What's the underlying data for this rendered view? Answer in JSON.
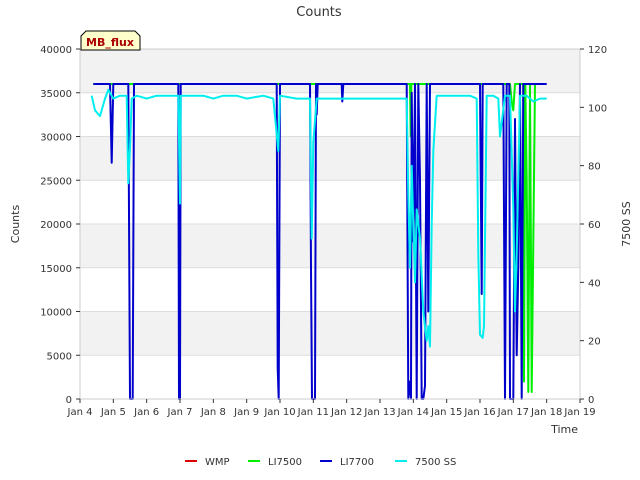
{
  "chart_data": {
    "type": "line",
    "title": "Counts",
    "xlabel": "Time",
    "ylabel": "Counts",
    "y2label": "7500 SS",
    "site_label": "MB_flux",
    "x_ticks": [
      {
        "v": 4,
        "label": "Jan 4"
      },
      {
        "v": 5,
        "label": "Jan 5"
      },
      {
        "v": 6,
        "label": "Jan 6"
      },
      {
        "v": 7,
        "label": "Jan 7"
      },
      {
        "v": 8,
        "label": "Jan 8"
      },
      {
        "v": 9,
        "label": "Jan 9"
      },
      {
        "v": 10,
        "label": "Jan 10"
      },
      {
        "v": 11,
        "label": "Jan 11"
      },
      {
        "v": 12,
        "label": "Jan 12"
      },
      {
        "v": 13,
        "label": "Jan 13"
      },
      {
        "v": 14,
        "label": "Jan 14"
      },
      {
        "v": 15,
        "label": "Jan 15"
      },
      {
        "v": 16,
        "label": "Jan 16"
      },
      {
        "v": 17,
        "label": "Jan 17"
      },
      {
        "v": 18,
        "label": "Jan 18"
      },
      {
        "v": 19,
        "label": "Jan 19"
      }
    ],
    "xlim": [
      4,
      19
    ],
    "ylim": [
      0,
      40000
    ],
    "y_ticks": [
      0,
      5000,
      10000,
      15000,
      20000,
      25000,
      30000,
      35000,
      40000
    ],
    "y2lim": [
      0,
      120
    ],
    "y2_ticks": [
      0,
      20,
      40,
      60,
      80,
      100,
      120
    ],
    "grid": true,
    "legend_position": "bottom-center",
    "series": [
      {
        "name": "WMP",
        "axis": "left",
        "color": "#dd0000",
        "points": []
      },
      {
        "name": "LI7500",
        "axis": "left",
        "color": "#00ee00",
        "points": [
          [
            4.4,
            36000
          ],
          [
            13.9,
            36000
          ],
          [
            13.92,
            30000
          ],
          [
            13.94,
            36000
          ],
          [
            16.9,
            36000
          ],
          [
            16.95,
            34000
          ],
          [
            17.0,
            33000
          ],
          [
            17.05,
            36000
          ],
          [
            17.3,
            36000
          ],
          [
            17.32,
            2000
          ],
          [
            17.36,
            36000
          ],
          [
            17.4,
            25000
          ],
          [
            17.45,
            800
          ],
          [
            17.5,
            36000
          ],
          [
            17.55,
            800
          ],
          [
            17.6,
            18000
          ],
          [
            17.65,
            36000
          ],
          [
            17.7,
            36000
          ]
        ]
      },
      {
        "name": "LI7700",
        "axis": "left",
        "color": "#0000cc",
        "points": [
          [
            4.4,
            36000
          ],
          [
            4.9,
            36000
          ],
          [
            4.95,
            27000
          ],
          [
            5.0,
            36000
          ],
          [
            5.45,
            36000
          ],
          [
            5.5,
            0
          ],
          [
            5.58,
            0
          ],
          [
            5.62,
            36000
          ],
          [
            6.95,
            36000
          ],
          [
            6.97,
            0
          ],
          [
            7.0,
            0
          ],
          [
            7.02,
            36000
          ],
          [
            9.9,
            36000
          ],
          [
            9.93,
            3500
          ],
          [
            9.96,
            0
          ],
          [
            10.0,
            36000
          ],
          [
            10.9,
            36000
          ],
          [
            10.93,
            15000
          ],
          [
            10.96,
            0
          ],
          [
            11.05,
            0
          ],
          [
            11.08,
            36000
          ],
          [
            11.1,
            32500
          ],
          [
            11.13,
            36000
          ],
          [
            11.85,
            36000
          ],
          [
            11.87,
            34000
          ],
          [
            11.9,
            36000
          ],
          [
            13.8,
            36000
          ],
          [
            13.85,
            0
          ],
          [
            13.9,
            2000
          ],
          [
            13.93,
            0
          ],
          [
            13.95,
            35000
          ],
          [
            14.0,
            18000
          ],
          [
            14.05,
            36000
          ],
          [
            14.1,
            0
          ],
          [
            14.15,
            36000
          ],
          [
            14.2,
            25000
          ],
          [
            14.25,
            0
          ],
          [
            14.3,
            0
          ],
          [
            14.35,
            1500
          ],
          [
            14.4,
            36000
          ],
          [
            14.45,
            10000
          ],
          [
            14.5,
            36000
          ],
          [
            16.0,
            36000
          ],
          [
            16.05,
            12000
          ],
          [
            16.08,
            36000
          ],
          [
            16.7,
            36000
          ],
          [
            16.75,
            0
          ],
          [
            16.8,
            36000
          ],
          [
            16.88,
            36000
          ],
          [
            16.9,
            0
          ],
          [
            17.0,
            0
          ],
          [
            17.05,
            32000
          ],
          [
            17.1,
            5000
          ],
          [
            17.15,
            15000
          ],
          [
            17.2,
            36000
          ],
          [
            17.25,
            0
          ],
          [
            17.3,
            36000
          ],
          [
            18.0,
            36000
          ]
        ]
      },
      {
        "name": "7500 SS",
        "axis": "right",
        "color": "#00eeee",
        "points": [
          [
            4.35,
            104
          ],
          [
            4.45,
            99
          ],
          [
            4.6,
            97
          ],
          [
            4.75,
            103
          ],
          [
            4.85,
            106
          ],
          [
            5.0,
            103
          ],
          [
            5.2,
            104
          ],
          [
            5.4,
            104
          ],
          [
            5.45,
            74
          ],
          [
            5.5,
            86
          ],
          [
            5.55,
            103
          ],
          [
            5.7,
            104
          ],
          [
            6.0,
            103
          ],
          [
            6.3,
            104
          ],
          [
            6.6,
            104
          ],
          [
            6.95,
            104
          ],
          [
            7.0,
            67
          ],
          [
            7.02,
            104
          ],
          [
            7.3,
            104
          ],
          [
            7.7,
            104
          ],
          [
            8.0,
            103
          ],
          [
            8.3,
            104
          ],
          [
            8.7,
            104
          ],
          [
            9.0,
            103
          ],
          [
            9.5,
            104
          ],
          [
            9.8,
            103
          ],
          [
            9.95,
            85
          ],
          [
            10.0,
            104
          ],
          [
            10.5,
            103
          ],
          [
            10.9,
            103
          ],
          [
            10.95,
            55
          ],
          [
            11.0,
            88
          ],
          [
            11.1,
            103
          ],
          [
            11.5,
            103
          ],
          [
            11.8,
            103
          ],
          [
            12.2,
            103
          ],
          [
            12.6,
            103
          ],
          [
            13.0,
            103
          ],
          [
            13.5,
            103
          ],
          [
            13.8,
            103
          ],
          [
            13.85,
            70
          ],
          [
            13.9,
            45
          ],
          [
            13.95,
            80
          ],
          [
            14.0,
            60
          ],
          [
            14.05,
            40
          ],
          [
            14.1,
            65
          ],
          [
            14.2,
            55
          ],
          [
            14.3,
            30
          ],
          [
            14.4,
            20
          ],
          [
            14.45,
            25
          ],
          [
            14.5,
            18
          ],
          [
            14.55,
            60
          ],
          [
            14.6,
            85
          ],
          [
            14.7,
            104
          ],
          [
            15.0,
            104
          ],
          [
            15.4,
            104
          ],
          [
            15.7,
            104
          ],
          [
            15.9,
            103
          ],
          [
            15.95,
            50
          ],
          [
            16.0,
            22
          ],
          [
            16.08,
            21
          ],
          [
            16.12,
            25
          ],
          [
            16.2,
            104
          ],
          [
            16.4,
            104
          ],
          [
            16.55,
            103
          ],
          [
            16.6,
            90
          ],
          [
            16.75,
            104
          ],
          [
            16.9,
            104
          ],
          [
            17.0,
            65
          ],
          [
            17.05,
            30
          ],
          [
            17.1,
            50
          ],
          [
            17.2,
            104
          ],
          [
            17.4,
            104
          ],
          [
            17.6,
            102
          ],
          [
            17.8,
            103
          ],
          [
            18.0,
            103
          ]
        ]
      }
    ]
  }
}
